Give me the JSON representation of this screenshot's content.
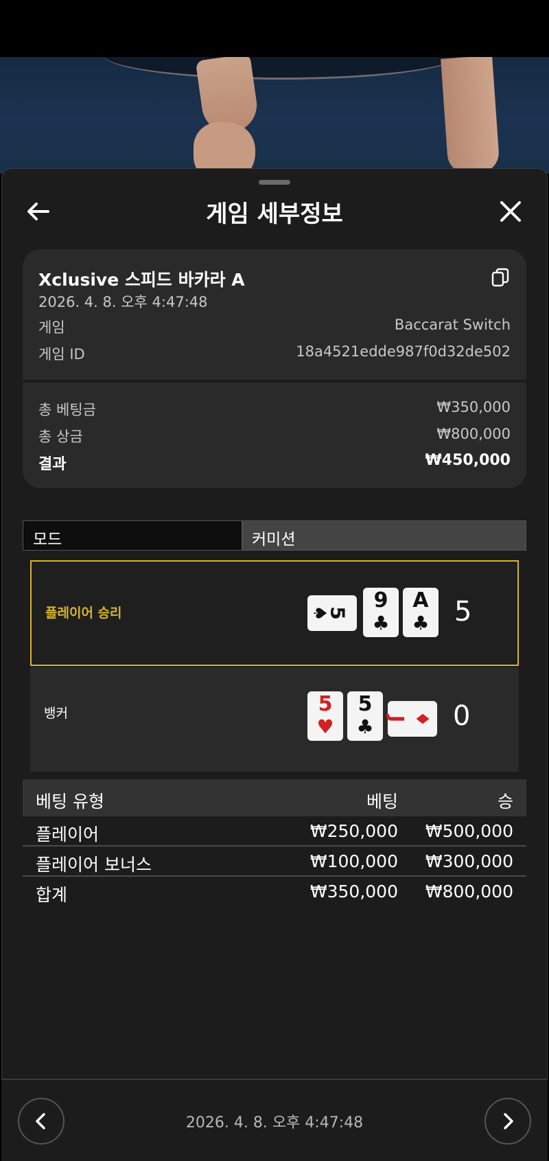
{
  "header": {
    "title": "게임 세부정보"
  },
  "summary": {
    "game_name": "Xclusive 스피드 바카라 A",
    "timestamp": "2026. 4. 8. 오후 4:47:48",
    "game_label": "게임",
    "game_value": "Baccarat Switch",
    "game_id_label": "게임 ID",
    "game_id_value": "18a4521edde987f0d32de502",
    "total_bet_label": "총 베팅금",
    "total_bet_value": "₩350,000",
    "total_win_label": "총 상금",
    "total_win_value": "₩800,000",
    "result_label": "결과",
    "result_value": "₩450,000"
  },
  "mode": {
    "label": "모드",
    "value": "커미션"
  },
  "results": {
    "player": {
      "label": "플레이어 승리",
      "score": "5",
      "cards": [
        {
          "rank": "5",
          "suit": "♠",
          "color": "#111111",
          "orientation": "sideways"
        },
        {
          "rank": "9",
          "suit": "♣",
          "color": "#111111",
          "orientation": "upright"
        },
        {
          "rank": "A",
          "suit": "♣",
          "color": "#111111",
          "orientation": "upright"
        }
      ]
    },
    "banker": {
      "label": "뱅커",
      "score": "0",
      "cards": [
        {
          "rank": "5",
          "suit": "♥",
          "color": "#d32020",
          "orientation": "upright"
        },
        {
          "rank": "5",
          "suit": "♣",
          "color": "#111111",
          "orientation": "upright"
        },
        {
          "rank": "J",
          "suit": "♦",
          "color": "#d32020",
          "orientation": "sideways"
        }
      ]
    }
  },
  "bet_table": {
    "headers": {
      "type": "베팅 유형",
      "bet": "베팅",
      "win": "승"
    },
    "rows": [
      {
        "type": "플레이어",
        "bet": "₩250,000",
        "win": "₩500,000"
      },
      {
        "type": "플레이어 보너스",
        "bet": "₩100,000",
        "win": "₩300,000"
      },
      {
        "type": "합계",
        "bet": "₩350,000",
        "win": "₩800,000"
      }
    ]
  },
  "footer": {
    "timestamp": "2026. 4. 8. 오후 4:47:48"
  },
  "colors": {
    "accent": "#d8b629",
    "background": "#1c1c1c",
    "card_bg": "#2a2a2a"
  }
}
